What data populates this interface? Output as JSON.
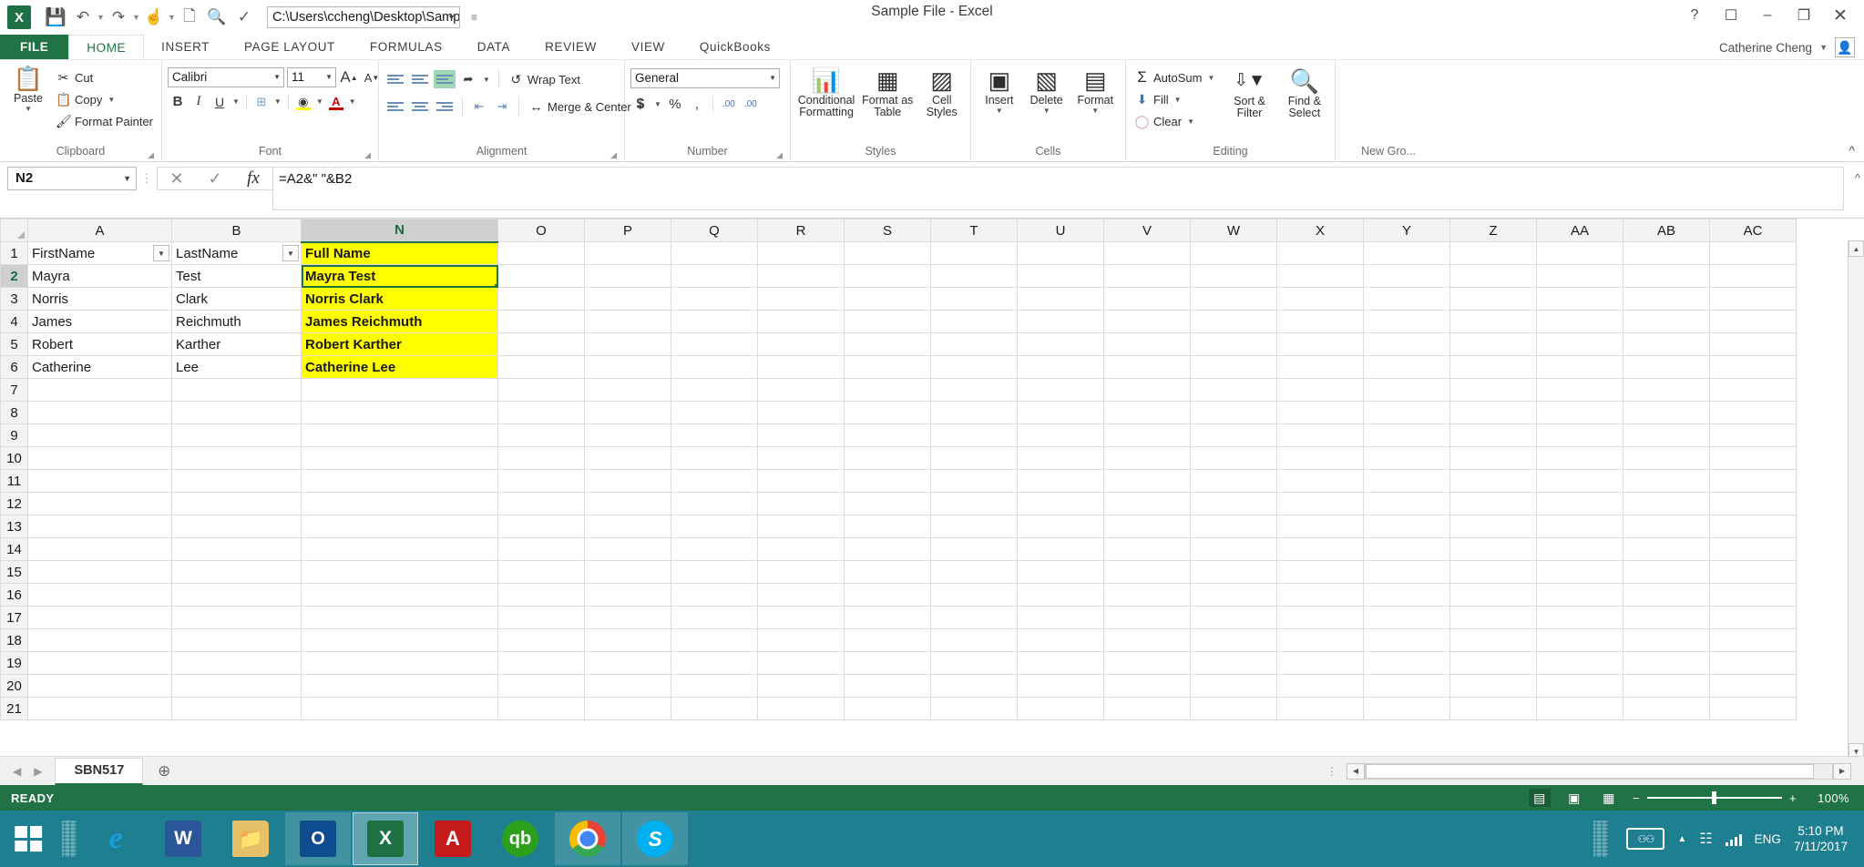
{
  "window": {
    "title": "Sample File - Excel",
    "app_logo": "X",
    "controls": [
      {
        "name": "help-button",
        "glyph": "?"
      },
      {
        "name": "ribbon-display-options-button",
        "glyph": "❐"
      },
      {
        "name": "minimize-button",
        "glyph": "–"
      },
      {
        "name": "restore-button",
        "glyph": "❐"
      },
      {
        "name": "close-button",
        "glyph": "✕"
      }
    ]
  },
  "quick_access": {
    "buttons": [
      {
        "name": "save-button",
        "glyph": "💾"
      },
      {
        "name": "undo-button",
        "glyph": "↶"
      },
      {
        "name": "redo-button",
        "glyph": "↷"
      },
      {
        "name": "touch-mode-button",
        "glyph": "☝"
      },
      {
        "name": "print-preview-button",
        "glyph": "🗋"
      },
      {
        "name": "quick-print-button",
        "glyph": "🔍"
      },
      {
        "name": "spelling-button",
        "glyph": "✓"
      }
    ],
    "path_value": "C:\\Users\\ccheng\\Desktop\\Samp",
    "customize_glyph": "☰"
  },
  "ribbon": {
    "file_tab": "FILE",
    "tabs": [
      "HOME",
      "INSERT",
      "PAGE LAYOUT",
      "FORMULAS",
      "DATA",
      "REVIEW",
      "VIEW",
      "QuickBooks"
    ],
    "active_tab": "HOME",
    "user_name": "Catherine Cheng",
    "collapse_glyph": "⌃",
    "groups": {
      "clipboard": {
        "label": "Clipboard",
        "paste": "Paste",
        "cut": "Cut",
        "copy": "Copy",
        "format_painter": "Format Painter"
      },
      "font": {
        "label": "Font",
        "font_name": "Calibri",
        "font_size": "11",
        "grow_font": "A",
        "shrink_font": "A",
        "bold": "B",
        "italic": "I",
        "underline": "U",
        "borders": "⊞",
        "fill_color": "A",
        "font_color": "A"
      },
      "alignment": {
        "label": "Alignment",
        "wrap_text": "Wrap Text",
        "merge_center": "Merge & Center"
      },
      "number": {
        "label": "Number",
        "format_value": "General",
        "currency": "$",
        "percent": "%",
        "comma": ",",
        "increase_decimal": ".00",
        "decrease_decimal": ".00"
      },
      "styles": {
        "label": "Styles",
        "conditional_formatting": "Conditional Formatting",
        "format_as_table": "Format as Table",
        "cell_styles": "Cell Styles"
      },
      "cells": {
        "label": "Cells",
        "insert": "Insert",
        "delete": "Delete",
        "format": "Format"
      },
      "editing": {
        "label": "Editing",
        "autosum": "AutoSum",
        "fill": "Fill",
        "clear": "Clear",
        "sort_filter": "Sort & Filter",
        "find_select": "Find & Select"
      },
      "new_group": {
        "label": "New Gro..."
      }
    }
  },
  "formula_bar": {
    "name_box": "N2",
    "cancel_glyph": "✕",
    "enter_glyph": "✓",
    "fx_glyph": "fx",
    "formula": "=A2&\" \"&B2",
    "expand_glyph": "⌃"
  },
  "grid": {
    "columns": [
      "A",
      "B",
      "N",
      "O",
      "P",
      "Q",
      "R",
      "S",
      "T",
      "U",
      "V",
      "W",
      "X",
      "Y",
      "Z",
      "AA",
      "AB",
      "AC"
    ],
    "selected_column": "N",
    "rows": [
      1,
      2,
      3,
      4,
      5,
      6,
      7,
      8,
      9,
      10,
      11,
      12,
      13,
      14,
      15,
      16,
      17,
      18,
      19,
      20,
      21
    ],
    "selected_row": 2,
    "active_cell": "N2",
    "highlight_color": "#ffff00",
    "filter_glyph": "▼",
    "data": [
      {
        "row": 1,
        "A": "FirstName",
        "B": "LastName",
        "N": "Full Name",
        "filter": true,
        "highlight": true
      },
      {
        "row": 2,
        "A": "Mayra",
        "B": "Test",
        "N": "Mayra Test",
        "filter": false,
        "highlight": true
      },
      {
        "row": 3,
        "A": "Norris",
        "B": "Clark",
        "N": "Norris Clark",
        "filter": false,
        "highlight": true
      },
      {
        "row": 4,
        "A": "James",
        "B": "Reichmuth",
        "N": "James Reichmuth",
        "filter": false,
        "highlight": true
      },
      {
        "row": 5,
        "A": "Robert",
        "B": "Karther",
        "N": "Robert Karther",
        "filter": false,
        "highlight": true
      },
      {
        "row": 6,
        "A": "Catherine",
        "B": "Lee",
        "N": "Catherine Lee",
        "filter": false,
        "highlight": true
      }
    ]
  },
  "sheet_tabs": {
    "prev_glyph": "◀",
    "next_glyph": "▶",
    "tabs": [
      "SBN517"
    ],
    "active": "SBN517",
    "add_glyph": "⊕",
    "scroll_left_glyph": "◀",
    "scroll_right_glyph": "▶"
  },
  "status_bar": {
    "status": "READY",
    "views": [
      {
        "name": "normal-view-button",
        "glyph": "▦",
        "active": true
      },
      {
        "name": "page-layout-view-button",
        "glyph": "▤",
        "active": false
      },
      {
        "name": "page-break-preview-button",
        "glyph": "▣",
        "active": false
      }
    ],
    "zoom_out": "−",
    "zoom_in": "+",
    "zoom_level": "100%"
  },
  "taskbar": {
    "start_glyph": "⊞",
    "apps": [
      {
        "name": "taskbar-internet-explorer",
        "glyph": "e",
        "cls": "ic-ie",
        "state": ""
      },
      {
        "name": "taskbar-word",
        "glyph": "W",
        "cls": "ic-word",
        "state": ""
      },
      {
        "name": "taskbar-file-explorer",
        "glyph": "📁",
        "cls": "ic-folder",
        "state": ""
      },
      {
        "name": "taskbar-outlook",
        "glyph": "O",
        "cls": "ic-outlook",
        "state": "open"
      },
      {
        "name": "taskbar-excel",
        "glyph": "X",
        "cls": "ic-excel",
        "state": "active"
      },
      {
        "name": "taskbar-adobe-reader",
        "glyph": "A",
        "cls": "ic-pdf",
        "state": ""
      },
      {
        "name": "taskbar-quickbooks",
        "glyph": "qb",
        "cls": "ic-qb",
        "state": ""
      },
      {
        "name": "taskbar-chrome",
        "glyph": "",
        "cls": "ic-chrome",
        "state": "open"
      },
      {
        "name": "taskbar-skype",
        "glyph": "S",
        "cls": "ic-skype",
        "state": "open"
      }
    ],
    "tray": {
      "keyboard_glyph": "⌨",
      "show_hidden_glyph": "▲",
      "network_glyph": "὏6",
      "language": "ENG",
      "time": "5:10 PM",
      "date": "7/11/2017"
    }
  }
}
